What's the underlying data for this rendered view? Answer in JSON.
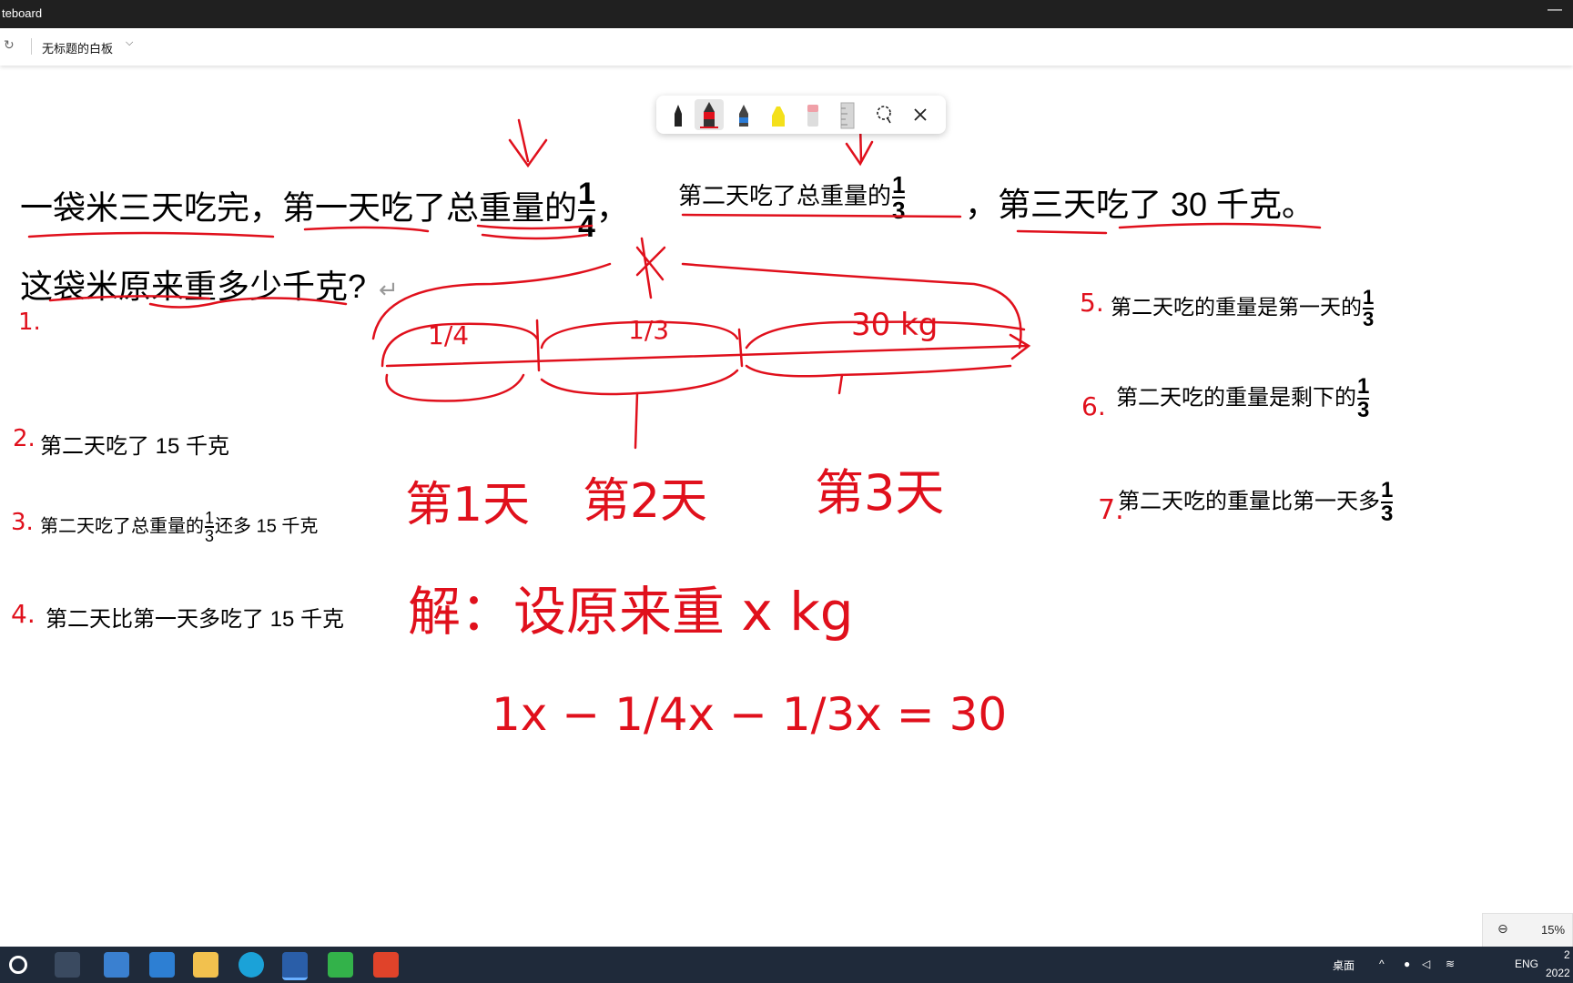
{
  "window": {
    "title": "teboard"
  },
  "header": {
    "board_title": "无标题的白板"
  },
  "problem": {
    "line1_a": "一袋米三天吃完，第一天吃了总重量的",
    "frac1_num": "1",
    "frac1_den": "4",
    "comma": "，",
    "line1_b": "第二天吃了总重量的",
    "frac2_num": "1",
    "frac2_den": "3",
    "line1_c": "，第三天吃了 30 千克。",
    "line2": "这袋米原来重多少千克?"
  },
  "conditions": [
    {
      "num": "1.",
      "text": ""
    },
    {
      "num": "2.",
      "text": "第二天吃了 15 千克"
    },
    {
      "num": "3.",
      "text_a": "第二天吃了总重量的",
      "frac_num": "1",
      "frac_den": "3",
      "text_b": "还多 15 千克"
    },
    {
      "num": "4.",
      "text": "第二天比第一天多吃了 15 千克"
    },
    {
      "num": "5.",
      "text": "第二天吃的重量是第一天的",
      "frac_num": "1",
      "frac_den": "3"
    },
    {
      "num": "6.",
      "text": "第二天吃的重量是剩下的",
      "frac_num": "1",
      "frac_den": "3"
    },
    {
      "num": "7.",
      "text": "第二天吃的重量比第一天多",
      "frac_num": "1",
      "frac_den": "3"
    }
  ],
  "ink": {
    "seg1": "1/4",
    "seg2": "1/3",
    "seg3": "30 kg",
    "day1": "第1天",
    "day2": "第2天",
    "day3": "第3天",
    "solution": "解：设原来重 x kg",
    "equation": "1x − 1/4x − 1/3x = 30"
  },
  "toolbar": {
    "tools": [
      "black-pen",
      "red-pen",
      "blue-pen",
      "yellow-highlighter",
      "eraser",
      "ruler",
      "lasso",
      "close"
    ]
  },
  "zoom": {
    "value": "15%"
  },
  "taskbar": {
    "tray_desktop": "桌面",
    "tray_lang": "ENG",
    "clock_top": "2",
    "clock_bottom": "2022"
  },
  "colors": {
    "ink": "#e0101c",
    "taskbar": "#1f2a3a"
  }
}
